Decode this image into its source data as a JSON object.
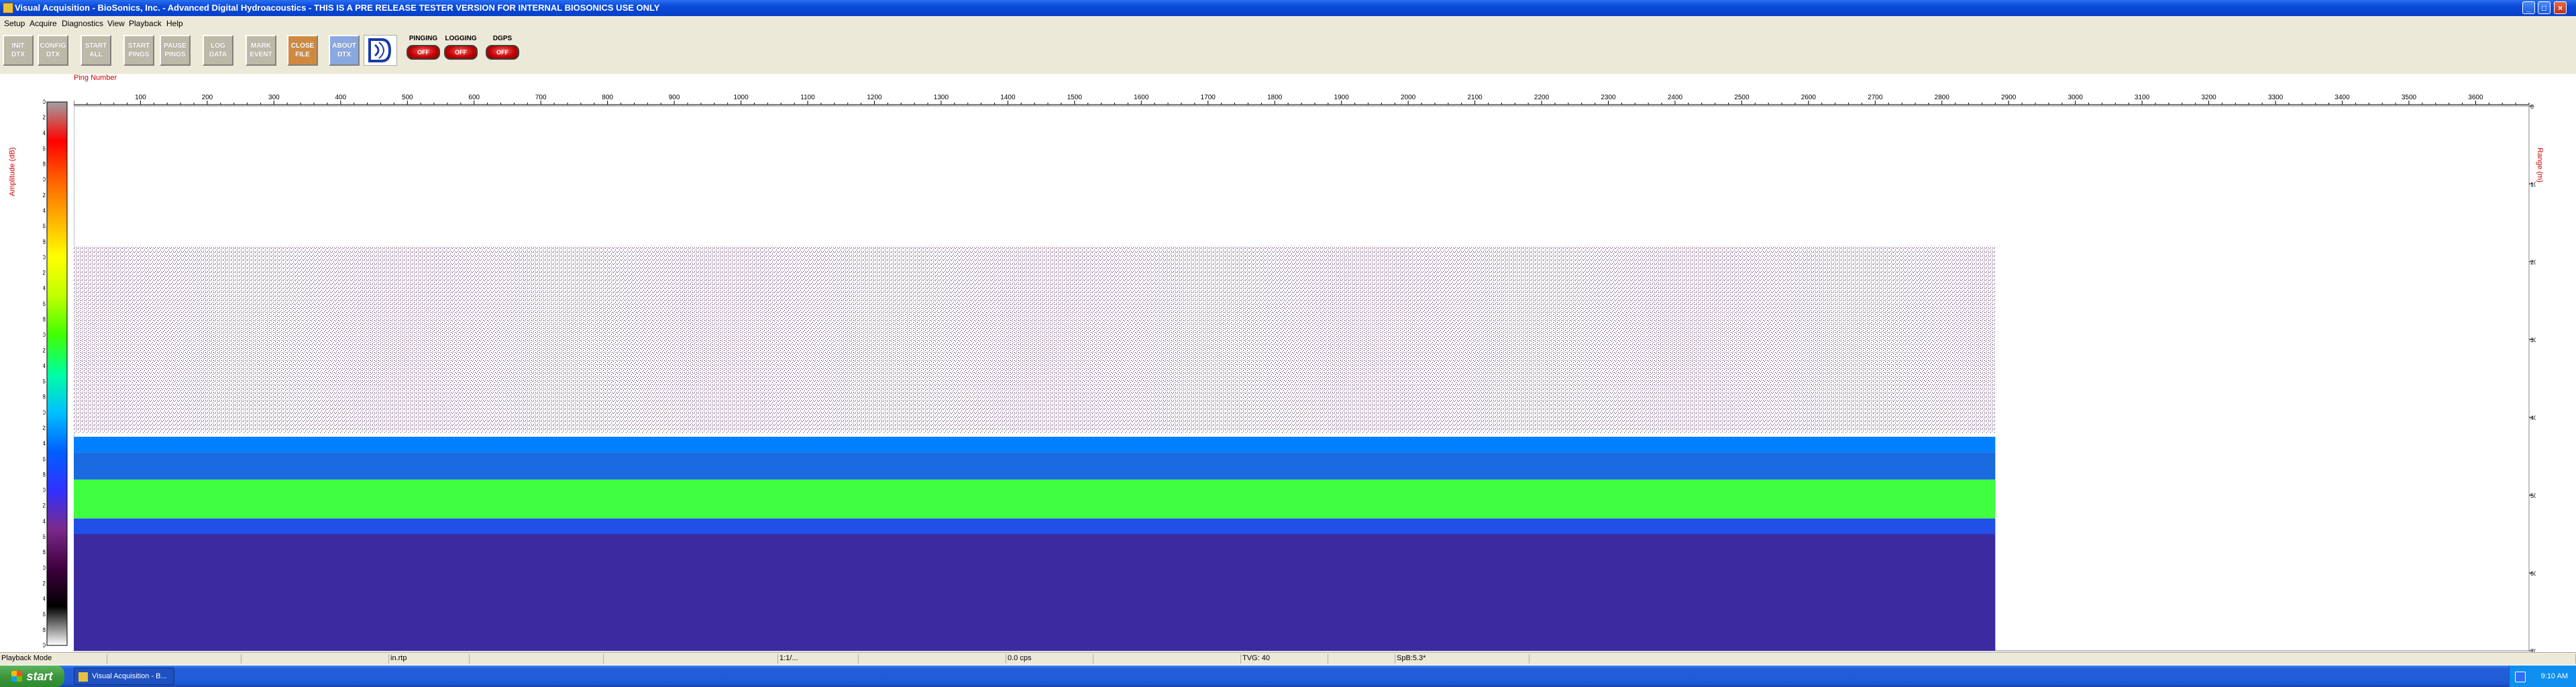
{
  "window": {
    "title": "Visual Acquisition - BioSonics, Inc. - Advanced Digital Hydroacoustics - THIS IS A PRE RELEASE TESTER VERSION FOR INTERNAL BIOSONICS USE ONLY",
    "minimize": "_",
    "maximize": "□",
    "close": "×"
  },
  "menu": [
    "Setup",
    "Acquire",
    "Diagnostics",
    "View",
    "Playback",
    "Help"
  ],
  "toolbar": {
    "buttons": [
      "INIT\nDTX",
      "CONFIG\nDTX",
      "START\nALL",
      "START\nPINGS",
      "PAUSE\nPINGS",
      "LOG\nDATA",
      "MARK\nEVENT",
      "CLOSE\nFILE",
      "ABOUT\nDTX"
    ],
    "indicators": [
      {
        "label": "PINGING",
        "lamp": "OFF"
      },
      {
        "label": "LOGGING",
        "lamp": "OFF"
      },
      {
        "label": "DGPS",
        "lamp": "OFF"
      }
    ]
  },
  "plot": {
    "x_title": "Ping Number",
    "y_left_title": "Amplitude (dB)",
    "y_right_title": "Range (m)"
  },
  "chart_data": {
    "type": "heatmap",
    "xlabel": "Ping Number",
    "ylabel": "Range (m)",
    "x_ticks": [
      100,
      200,
      300,
      400,
      500,
      600,
      700,
      800,
      900,
      1000,
      1100,
      1200,
      1300,
      1400,
      1500,
      1600,
      1700,
      1800,
      1900,
      2000,
      2100,
      2200,
      2300,
      2400,
      2500,
      2600,
      2700,
      2800,
      2900,
      3000,
      3100,
      3200,
      3300,
      3400,
      3500,
      3600
    ],
    "xlim": [
      0,
      3680
    ],
    "data_extent_pings": [
      0,
      2880
    ],
    "y_right_ticks": [
      0,
      10,
      20,
      30,
      40,
      50,
      60,
      "70.0"
    ],
    "ylim": [
      0,
      70
    ],
    "colorbar": {
      "label": "Amplitude (dB)",
      "ticks": [
        0,
        -2,
        -4,
        -6,
        -8,
        -10,
        -12,
        -14,
        -16,
        -18,
        -20,
        -22,
        -24,
        -26,
        -28,
        -30,
        -32,
        -34,
        -36,
        -38,
        -40,
        -42,
        -44,
        -46,
        -48,
        -50,
        -52,
        -54,
        -56,
        -58,
        -60,
        -62,
        -64,
        -66,
        -68,
        -70
      ],
      "range": [
        -70,
        0
      ],
      "colors": [
        "#ffffff",
        "#000000",
        "#400040",
        "#7a2a8a",
        "#3030ff",
        "#0060ff",
        "#00c0ff",
        "#00ffa0",
        "#40ff00",
        "#c0ff00",
        "#ffff00",
        "#ffb000",
        "#ff6000",
        "#ff0000",
        "#a0a0a0"
      ]
    },
    "layers": [
      {
        "name": "plankton_scatter",
        "range_m": [
          18,
          42
        ],
        "color": "#4a1a5a"
      },
      {
        "name": "bottom_edge",
        "range_m": [
          42.5,
          44.5
        ],
        "color": "#0080ff"
      },
      {
        "name": "bottom_green",
        "range_m": [
          48,
          53
        ],
        "color": "#40ff40"
      },
      {
        "name": "sub_bottom",
        "range_m": [
          55,
          70
        ],
        "color": "#3c2aa0"
      }
    ]
  },
  "statusbar": [
    "Playback Mode",
    "",
    "",
    "in.rtp",
    "",
    "",
    "1:1/...",
    "",
    "0.0 cps",
    "",
    "TVG: 40",
    "",
    "SpB:5.3*",
    ""
  ],
  "taskbar": {
    "start": "start",
    "task": "Visual Acquisition - B...",
    "clock": "9:10 AM"
  }
}
